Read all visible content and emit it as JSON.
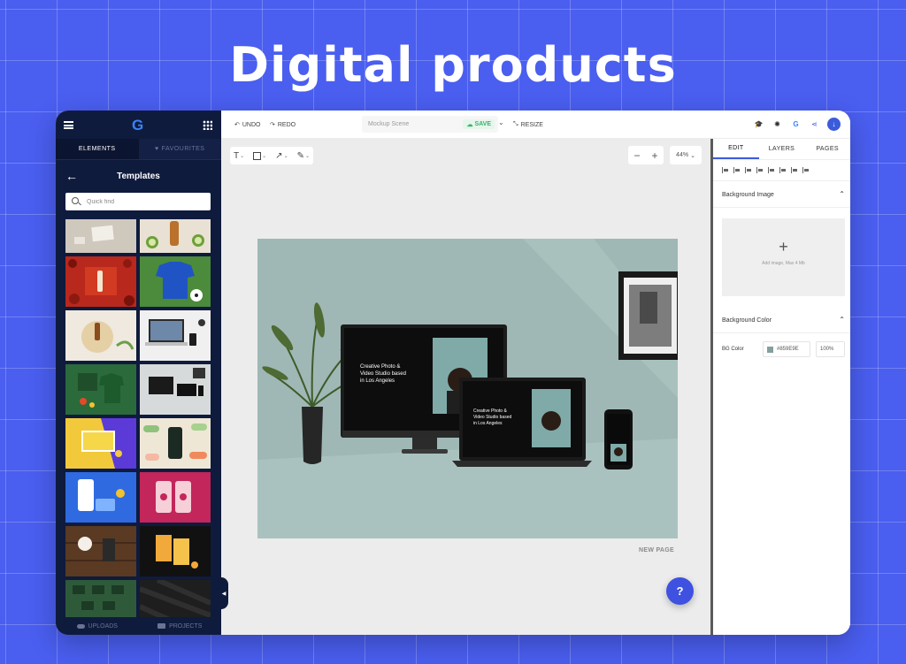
{
  "hero": {
    "title": "Digital products"
  },
  "left_panel": {
    "logo": "G",
    "tabs": [
      {
        "label": "ELEMENTS"
      },
      {
        "label": "FAVOURITES"
      }
    ],
    "header_title": "Templates",
    "search": {
      "placeholder": "Quick find"
    },
    "bottom_tabs": [
      {
        "label": "UPLOADS"
      },
      {
        "label": "PROJECTS"
      }
    ]
  },
  "topbar": {
    "undo_label": "UNDO",
    "redo_label": "REDO",
    "scene_name": "Mockup Scene",
    "save_label": "SAVE",
    "resize_label": "RESIZE"
  },
  "canvas": {
    "zoom": "44%",
    "new_page_label": "NEW PAGE",
    "help_label": "?",
    "monitor_text": "Creative Photo & Video Studio based in Los Angeles",
    "laptop_text": "Creative Photo & Video Studio based in Los Angeles"
  },
  "right_panel": {
    "tabs": [
      {
        "label": "EDIT"
      },
      {
        "label": "LAYERS"
      },
      {
        "label": "PAGES"
      }
    ],
    "background_image": {
      "title": "Background Image",
      "hint": "Add image, Max 4 Mb"
    },
    "background_color": {
      "title": "Background Color",
      "label": "BG Color",
      "value": "#859E9E",
      "opacity": "100%"
    }
  },
  "colors": {
    "page_bg": "#4a5ef0",
    "sidebar_bg": "#0f1b3d",
    "accent": "#3b5bdb",
    "save_green": "#3bb26a",
    "canvas_bg": "#9fb8b5"
  }
}
